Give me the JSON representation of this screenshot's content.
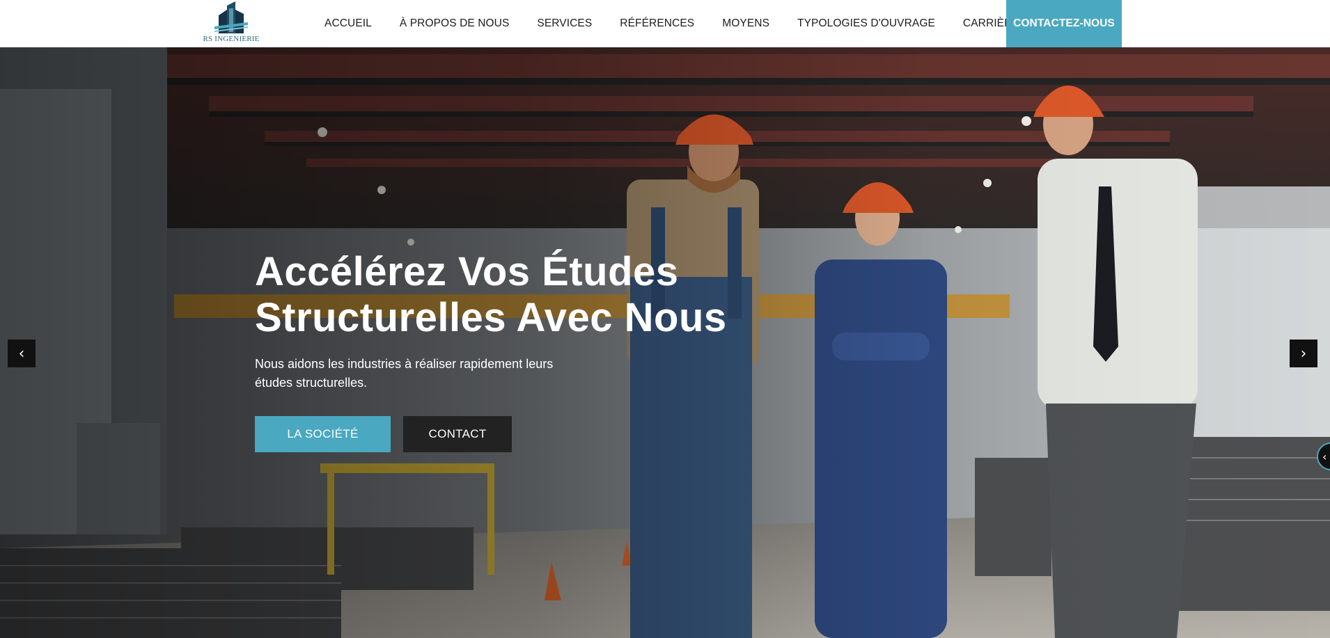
{
  "brand": {
    "name": "RS INGENIERIE"
  },
  "nav": {
    "items": [
      {
        "label": "ACCUEIL"
      },
      {
        "label": "À PROPOS DE NOUS"
      },
      {
        "label": "SERVICES"
      },
      {
        "label": "RÉFÉRENCES"
      },
      {
        "label": "MOYENS"
      },
      {
        "label": "TYPOLOGIES D'OUVRAGE"
      },
      {
        "label": "CARRIÈRE"
      }
    ],
    "cta": "CONTACTEZ-NOUS"
  },
  "hero": {
    "title": "Accélérez Vos Études Structurelles Avec Nous",
    "subtitle": "Nous aidons les industries à réaliser rapidement leurs études structurelles.",
    "primary_button": "LA SOCIÉTÉ",
    "secondary_button": "CONTACT",
    "prev_icon": "‹",
    "next_icon": "›",
    "side_tab_icon": "‹"
  },
  "colors": {
    "accent": "#4aa8c1",
    "dark": "#222222",
    "text": "#1b1b1b"
  }
}
